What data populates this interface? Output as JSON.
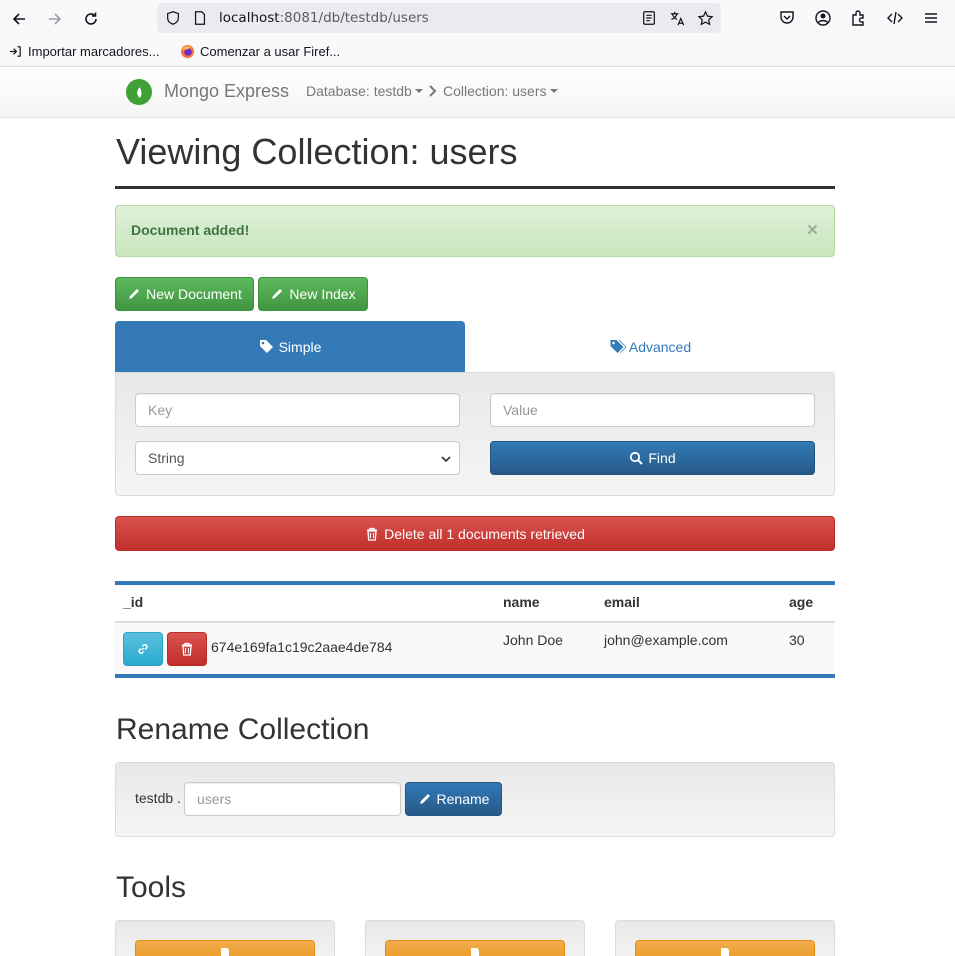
{
  "browser": {
    "url_host": "localhost",
    "url_rest": ":8081/db/testdb/users",
    "bookmarks": [
      {
        "label": "Importar marcadores...",
        "icon": "import-icon"
      },
      {
        "label": "Comenzar a usar Firef...",
        "icon": "firefox-icon"
      }
    ]
  },
  "navbar": {
    "brand": "Mongo Express",
    "database_label": "Database: testdb",
    "collection_label": "Collection: users"
  },
  "page": {
    "title": "Viewing Collection: users"
  },
  "alert": {
    "message": "Document added!",
    "close": "×"
  },
  "actions": {
    "new_document": "New Document",
    "new_index": "New Index"
  },
  "tabs": {
    "simple": "Simple",
    "advanced": "Advanced"
  },
  "search": {
    "key_placeholder": "Key",
    "value_placeholder": "Value",
    "type_selected": "String",
    "find_label": "Find"
  },
  "delete_all_label": "Delete all 1 documents retrieved",
  "table": {
    "columns": [
      "_id",
      "name",
      "email",
      "age"
    ],
    "rows": [
      {
        "_id": "674e169fa1c19c2aae4de784",
        "name": "John Doe",
        "email": "john@example.com",
        "age": "30"
      }
    ]
  },
  "rename": {
    "title": "Rename Collection",
    "db_prefix": "testdb .",
    "placeholder": "users",
    "button": "Rename"
  },
  "tools": {
    "title": "Tools"
  },
  "colors": {
    "primary": "#337ab7",
    "success": "#5cb85c",
    "danger": "#d9534f",
    "info": "#5bc0de",
    "warning": "#f0ad4e",
    "brand_green": "#3fa037"
  }
}
